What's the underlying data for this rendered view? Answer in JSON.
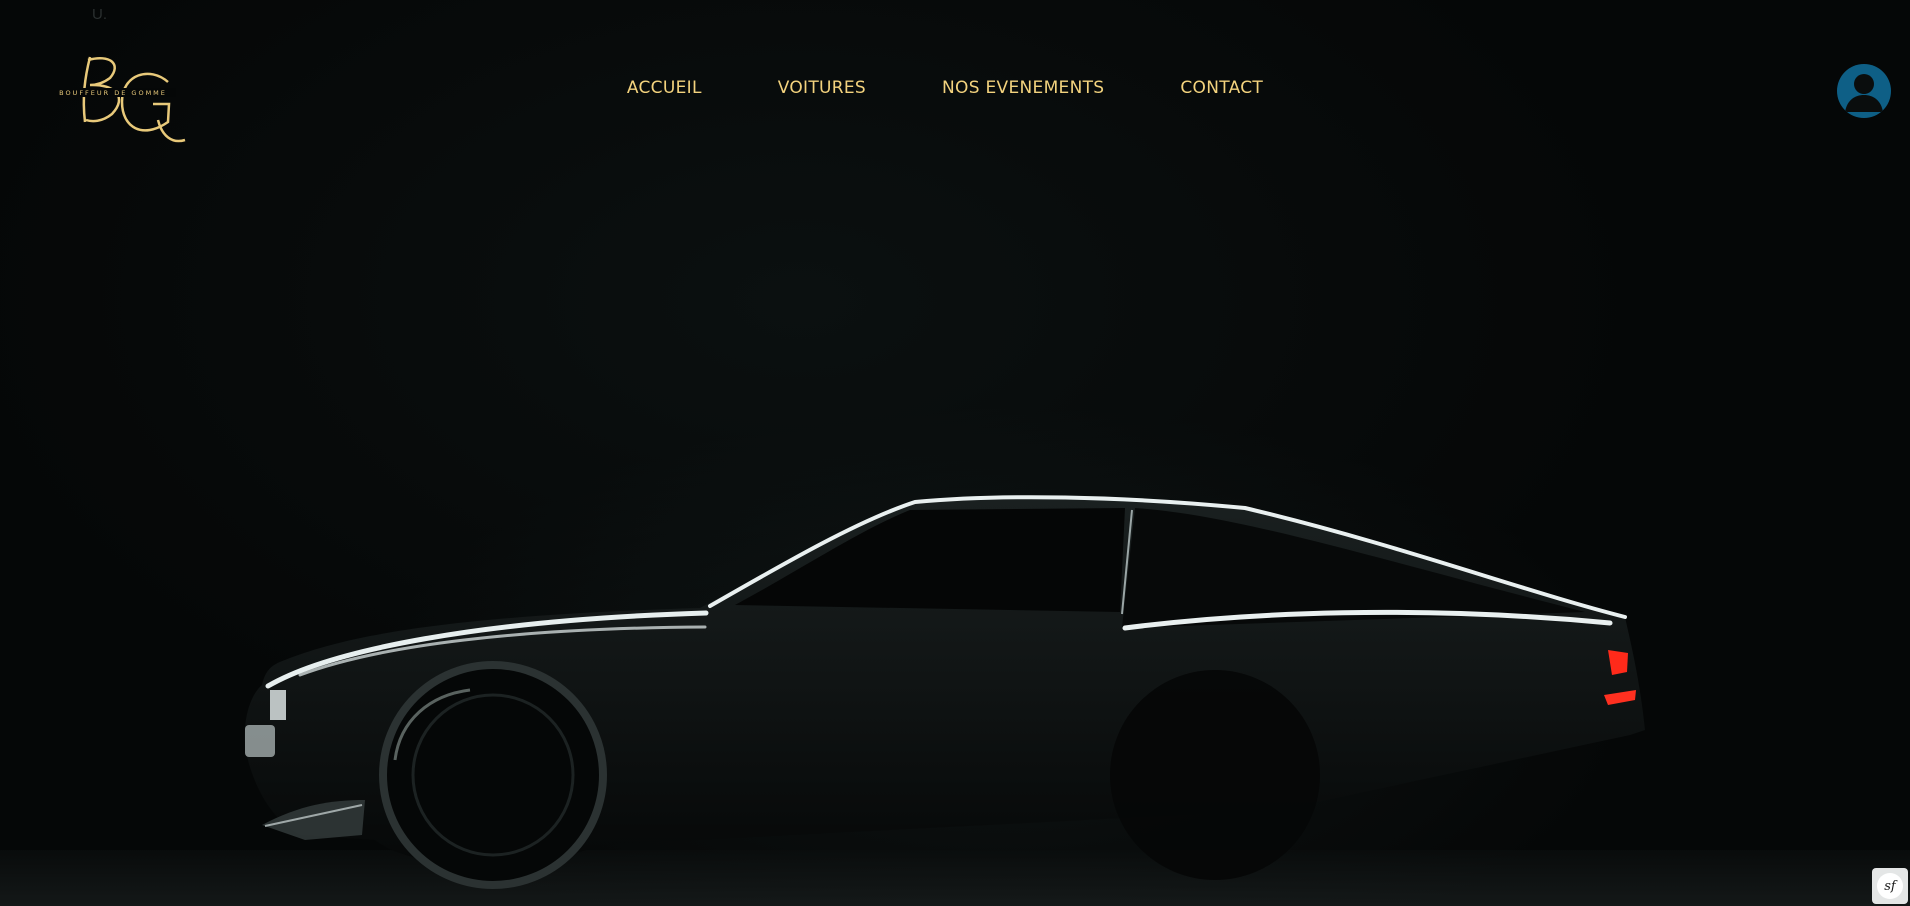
{
  "stray_text": "U.",
  "logo": {
    "monogram": "BG",
    "tagline": "BOUFFEUR DE GOMME",
    "color": "#e8c97a"
  },
  "nav": {
    "items": [
      {
        "label": "ACCUEIL"
      },
      {
        "label": "VOITURES"
      },
      {
        "label": "NOS EVENEMENTS"
      },
      {
        "label": "CONTACT"
      }
    ],
    "color": "#f3d37e"
  },
  "user": {
    "icon": "user-icon",
    "color": "#0e5f86"
  },
  "hero": {
    "image": "dark-sports-car-silhouette"
  },
  "debug_toolbar": {
    "label": "sf",
    "icon": "symfony-icon"
  }
}
